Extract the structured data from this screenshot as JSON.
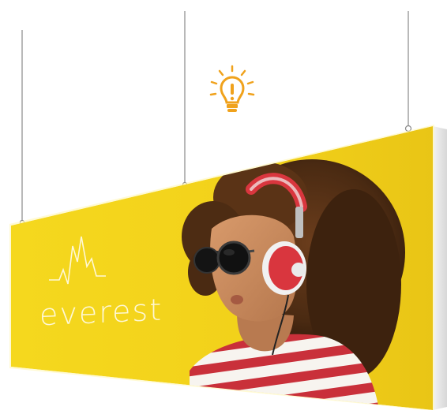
{
  "image": {
    "description_icon": "lightbulb-icon",
    "brand": {
      "name": "everest",
      "logo_icon": "mountain-heartbeat-icon"
    },
    "colors": {
      "banner_yellow": "#f2d41c",
      "bulb_orange": "#f0a21c",
      "headphone_red": "#d9363e",
      "shirt_red": "#c9303a",
      "hair_brown": "#4a2a14",
      "skin": "#c98a5e"
    }
  }
}
